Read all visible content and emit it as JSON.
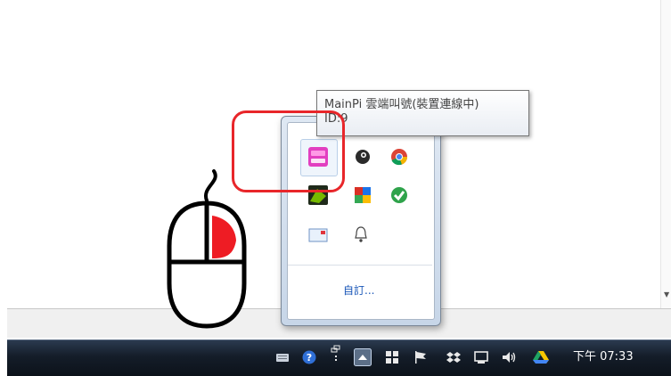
{
  "tooltip": {
    "line1": "MainPi 雲端叫號(裝置連線中)",
    "line2": "ID:9"
  },
  "overflow_panel": {
    "icons": [
      {
        "name": "mainpi",
        "selected": true
      },
      {
        "name": "steam"
      },
      {
        "name": "chrome"
      },
      {
        "name": "nvidia"
      },
      {
        "name": "colorful-squares"
      },
      {
        "name": "green-check"
      },
      {
        "name": "mail"
      },
      {
        "name": "bell"
      }
    ],
    "customize_label": "自訂..."
  },
  "taskbar": {
    "tray_icons": [
      "keyboard-icon",
      "help-icon",
      "network-icon",
      "show-hidden-icons-arrow",
      "windows-flag-icon",
      "action-center-flag-icon",
      "dropbox-icon",
      "device-icon",
      "volume-icon",
      "google-drive-icon"
    ],
    "clock": "下午 07:33"
  },
  "annotation": {
    "highlight_color": "#e8262a",
    "mouse_button": "right"
  }
}
